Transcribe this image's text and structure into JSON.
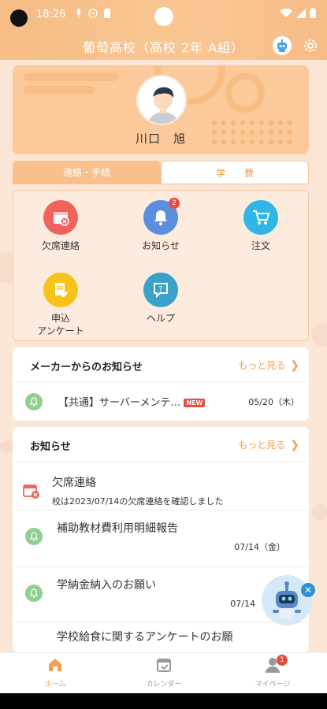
{
  "status_bar": {
    "time": "18:26"
  },
  "header": {
    "title": "葡萄高校（高校 2年 A組）"
  },
  "profile": {
    "name": "川口　旭"
  },
  "tabs": [
    {
      "label": "連絡・手続",
      "active": true
    },
    {
      "label": "学　　費",
      "active": false
    }
  ],
  "menu": [
    {
      "label": "欠席連絡",
      "icon": "absence-calendar-icon",
      "color": "#f0625c"
    },
    {
      "label": "お知らせ",
      "icon": "bell-icon",
      "color": "#5c8ee0",
      "badge": "2"
    },
    {
      "label": "注文",
      "icon": "cart-icon",
      "color": "#2fb6e6"
    },
    {
      "label": "申込\nアンケート",
      "label_line1": "申込",
      "label_line2": "アンケート",
      "icon": "form-icon",
      "color": "#f7c21a"
    },
    {
      "label": "ヘルプ",
      "icon": "help-icon",
      "color": "#3aa2c9"
    }
  ],
  "maker_notices": {
    "title": "メーカーからのお知らせ",
    "more": "もっと見る",
    "items": [
      {
        "title": "【共通】サーバーメンテ…",
        "new": "NEW",
        "date": "05/20（木）"
      }
    ]
  },
  "notices": {
    "title": "お知らせ",
    "more": "もっと見る",
    "items": [
      {
        "title": "欠席連絡",
        "sub": "校は2023/07/14の欠席連絡を確認しました",
        "icon": "absence-calendar-icon"
      },
      {
        "title": "補助教材費利用明細報告",
        "date": "07/14（金）",
        "icon": "bell-icon"
      },
      {
        "title": "学納金納入のお願い",
        "date": "07/14",
        "icon": "bell-icon"
      },
      {
        "title": "学校給食に関するアンケートのお願",
        "icon": "bell-icon"
      }
    ]
  },
  "bottom_nav": [
    {
      "label": "ホーム",
      "icon": "home-icon",
      "active": true
    },
    {
      "label": "カレンダー",
      "icon": "calendar-icon",
      "active": false
    },
    {
      "label": "マイページ",
      "icon": "person-icon",
      "active": false,
      "badge": "1"
    }
  ],
  "colors": {
    "accent": "#f29f53",
    "header": "#f8c08c",
    "badge": "#e94a3f"
  }
}
